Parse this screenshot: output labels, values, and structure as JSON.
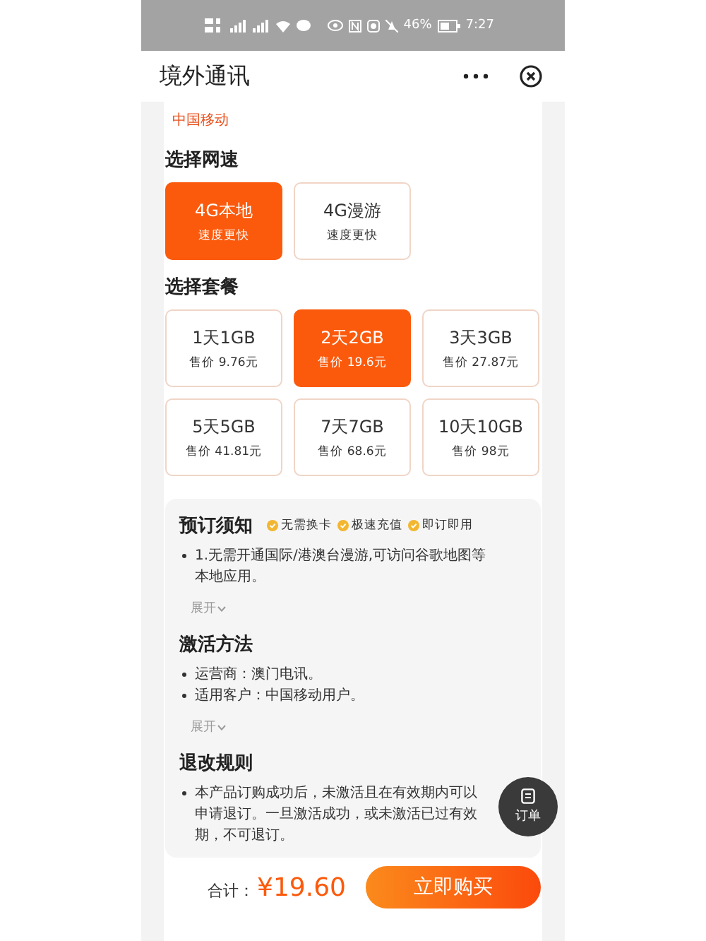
{
  "status_bar": {
    "battery": "46%",
    "time": "7:27"
  },
  "header": {
    "title": "境外通讯"
  },
  "carrier": "中国移动",
  "speed": {
    "heading": "选择网速",
    "options": [
      {
        "name": "4G本地",
        "note": "速度更快",
        "selected": true
      },
      {
        "name": "4G漫游",
        "note": "速度更快",
        "selected": false
      }
    ]
  },
  "plans": {
    "heading": "选择套餐",
    "options": [
      {
        "name": "1天1GB",
        "price": "售价 9.76元",
        "selected": false
      },
      {
        "name": "2天2GB",
        "price": "售价 19.6元",
        "selected": true
      },
      {
        "name": "3天3GB",
        "price": "售价 27.87元",
        "selected": false
      },
      {
        "name": "5天5GB",
        "price": "售价 41.81元",
        "selected": false
      },
      {
        "name": "7天7GB",
        "price": "售价 68.6元",
        "selected": false
      },
      {
        "name": "10天10GB",
        "price": "售价 98元",
        "selected": false
      }
    ]
  },
  "sections": [
    {
      "title": "预订须知",
      "tags": [
        "无需换卡",
        "极速充值",
        "即订即用"
      ],
      "bullets": [
        "1.无需开通国际/港澳台漫游,可访问谷歌地图等本地应用。"
      ],
      "toggle": "展开"
    },
    {
      "title": "激活方法",
      "bullets": [
        "运营商：澳门电讯。",
        "适用客户：中国移动用户。"
      ],
      "toggle": "展开"
    },
    {
      "title": "退改规则",
      "bullets": [
        "本产品订购成功后，未激活且在有效期内可以申请退订。一旦激活成功，或未激活已过有效期，不可退订。"
      ]
    }
  ],
  "order_button": "订单",
  "footer": {
    "total_label": "合计：",
    "total": "¥19.60",
    "buy": "立即购买"
  }
}
